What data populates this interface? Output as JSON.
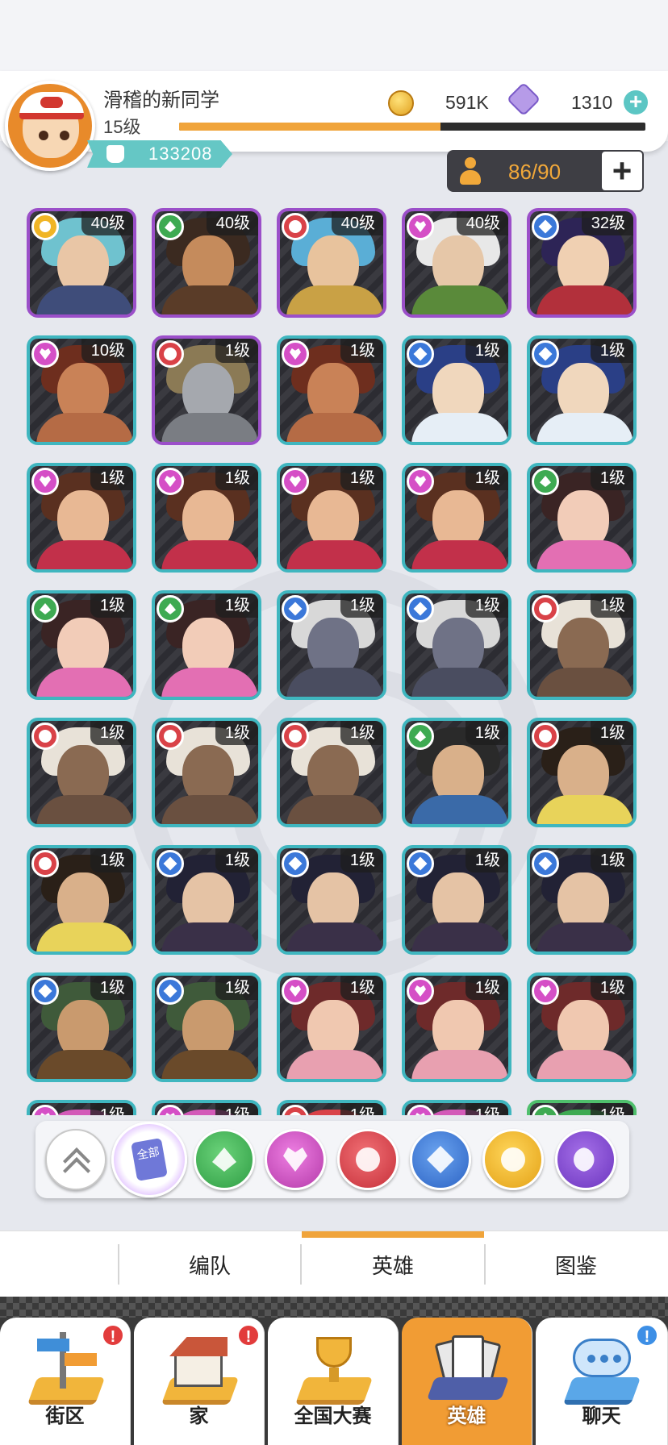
{
  "player": {
    "name": "滑稽的新同学",
    "level": "15级",
    "exp_progress": 0.56,
    "power": "133208"
  },
  "currency": {
    "coins": "591K",
    "gems": "1310",
    "coin_icon": "coin-icon",
    "gem_icon": "gem-icon"
  },
  "capacity": {
    "value": "86/90",
    "icon": "person-icon"
  },
  "colors": {
    "accent": "#f0a43b",
    "teal": "#65c7c5",
    "card_purple": "#9b4fc9",
    "card_teal": "#3fb6bf"
  },
  "heroes": [
    {
      "level": "40级",
      "element": "sun",
      "frame": "purple",
      "hair": "#6fc2cf",
      "skin": "#e9c6a6",
      "body": "#3f4d7a"
    },
    {
      "level": "40级",
      "element": "leaf",
      "frame": "purple",
      "hair": "#3b2a20",
      "skin": "#c58b5c",
      "body": "#5a3c28"
    },
    {
      "level": "40级",
      "element": "flower",
      "frame": "purple",
      "hair": "#5aaed6",
      "skin": "#e8c39d",
      "body": "#c9a145"
    },
    {
      "level": "40级",
      "element": "heart",
      "frame": "purple",
      "hair": "#e8e8e8",
      "skin": "#e6c7a8",
      "body": "#5a8a3a"
    },
    {
      "level": "32级",
      "element": "diamond",
      "frame": "purple",
      "hair": "#2d2456",
      "skin": "#f0d0b2",
      "body": "#b2303b"
    },
    {
      "level": "10级",
      "element": "heart",
      "frame": "teal",
      "hair": "#6e2e1e",
      "skin": "#c98257",
      "body": "#b56b45"
    },
    {
      "level": "1级",
      "element": "flower",
      "frame": "purple",
      "hair": "#8b7a55",
      "skin": "#a5a8ae",
      "body": "#7a7d83"
    },
    {
      "level": "1级",
      "element": "heart",
      "frame": "teal",
      "hair": "#6e2e1e",
      "skin": "#c98257",
      "body": "#b56b45"
    },
    {
      "level": "1级",
      "element": "diamond",
      "frame": "teal",
      "hair": "#2a3f86",
      "skin": "#f0d7bd",
      "body": "#e6eef6"
    },
    {
      "level": "1级",
      "element": "diamond",
      "frame": "teal",
      "hair": "#2a3f86",
      "skin": "#f0d7bd",
      "body": "#e6eef6"
    },
    {
      "level": "1级",
      "element": "heart",
      "frame": "teal",
      "hair": "#5a3020",
      "skin": "#e8b894",
      "body": "#c2304a"
    },
    {
      "level": "1级",
      "element": "heart",
      "frame": "teal",
      "hair": "#5a3020",
      "skin": "#e8b894",
      "body": "#c2304a"
    },
    {
      "level": "1级",
      "element": "heart",
      "frame": "teal",
      "hair": "#5a3020",
      "skin": "#e8b894",
      "body": "#c2304a"
    },
    {
      "level": "1级",
      "element": "heart",
      "frame": "teal",
      "hair": "#5a3020",
      "skin": "#e8b894",
      "body": "#c2304a"
    },
    {
      "level": "1级",
      "element": "leaf",
      "frame": "teal",
      "hair": "#3a2424",
      "skin": "#f2ccb8",
      "body": "#e36fb3"
    },
    {
      "level": "1级",
      "element": "leaf",
      "frame": "teal",
      "hair": "#3a2424",
      "skin": "#f2ccb8",
      "body": "#e36fb3"
    },
    {
      "level": "1级",
      "element": "leaf",
      "frame": "teal",
      "hair": "#3a2424",
      "skin": "#f2ccb8",
      "body": "#e36fb3"
    },
    {
      "level": "1级",
      "element": "diamond",
      "frame": "teal",
      "hair": "#d8d8d8",
      "skin": "#6f7286",
      "body": "#4a4d60"
    },
    {
      "level": "1级",
      "element": "diamond",
      "frame": "teal",
      "hair": "#d8d8d8",
      "skin": "#6f7286",
      "body": "#4a4d60"
    },
    {
      "level": "1级",
      "element": "flower",
      "frame": "teal",
      "hair": "#e8e2d8",
      "skin": "#8a6a52",
      "body": "#6a5040"
    },
    {
      "level": "1级",
      "element": "flower",
      "frame": "teal",
      "hair": "#e8e2d8",
      "skin": "#8a6a52",
      "body": "#6a5040"
    },
    {
      "level": "1级",
      "element": "flower",
      "frame": "teal",
      "hair": "#e8e2d8",
      "skin": "#8a6a52",
      "body": "#6a5040"
    },
    {
      "level": "1级",
      "element": "flower",
      "frame": "teal",
      "hair": "#e8e2d8",
      "skin": "#8a6a52",
      "body": "#6a5040"
    },
    {
      "level": "1级",
      "element": "leaf",
      "frame": "teal",
      "hair": "#2a2a2a",
      "skin": "#d9b08a",
      "body": "#3a6aa8"
    },
    {
      "level": "1级",
      "element": "flower",
      "frame": "teal",
      "hair": "#2a2018",
      "skin": "#d9b08a",
      "body": "#e8d35a"
    },
    {
      "level": "1级",
      "element": "flower",
      "frame": "teal",
      "hair": "#2a2018",
      "skin": "#d9b08a",
      "body": "#e8d35a"
    },
    {
      "level": "1级",
      "element": "diamond",
      "frame": "teal",
      "hair": "#222235",
      "skin": "#e5c3a5",
      "body": "#3a3048"
    },
    {
      "level": "1级",
      "element": "diamond",
      "frame": "teal",
      "hair": "#222235",
      "skin": "#e5c3a5",
      "body": "#3a3048"
    },
    {
      "level": "1级",
      "element": "diamond",
      "frame": "teal",
      "hair": "#222235",
      "skin": "#e5c3a5",
      "body": "#3a3048"
    },
    {
      "level": "1级",
      "element": "diamond",
      "frame": "teal",
      "hair": "#222235",
      "skin": "#e5c3a5",
      "body": "#3a3048"
    },
    {
      "level": "1级",
      "element": "diamond",
      "frame": "teal",
      "hair": "#3f5a3a",
      "skin": "#c99a6e",
      "body": "#6a4a2a"
    },
    {
      "level": "1级",
      "element": "diamond",
      "frame": "teal",
      "hair": "#3f5a3a",
      "skin": "#c99a6e",
      "body": "#6a4a2a"
    },
    {
      "level": "1级",
      "element": "heart",
      "frame": "teal",
      "hair": "#6e2a2a",
      "skin": "#f0c8b0",
      "body": "#e8a0b0"
    },
    {
      "level": "1级",
      "element": "heart",
      "frame": "teal",
      "hair": "#6e2a2a",
      "skin": "#f0c8b0",
      "body": "#e8a0b0"
    },
    {
      "level": "1级",
      "element": "heart",
      "frame": "teal",
      "hair": "#6e2a2a",
      "skin": "#f0c8b0",
      "body": "#e8a0b0"
    },
    {
      "level": "1级",
      "element": "heart",
      "frame": "teal",
      "hair": "#d35ab8",
      "skin": "#f0c8b0",
      "body": "#b04a9a"
    },
    {
      "level": "1级",
      "element": "heart",
      "frame": "teal",
      "hair": "#d35ab8",
      "skin": "#f0c8b0",
      "body": "#b04a9a"
    },
    {
      "level": "1级",
      "element": "flower",
      "frame": "teal",
      "hair": "#d94248",
      "skin": "#f0c8b0",
      "body": "#b03a3a"
    },
    {
      "level": "1级",
      "element": "heart",
      "frame": "teal",
      "hair": "#d35ab8",
      "skin": "#f0c8b0",
      "body": "#b04a9a"
    },
    {
      "level": "1级",
      "element": "leaf",
      "frame": "green",
      "hair": "#3eaa52",
      "skin": "#f0c8b0",
      "body": "#3a8a4a"
    }
  ],
  "filters": {
    "collapse_icon": "double-chevron-up-icon",
    "all_label": "全部",
    "items": [
      {
        "name": "leaf",
        "icon": "spade-leaf-icon"
      },
      {
        "name": "heart",
        "icon": "heart-gem-icon"
      },
      {
        "name": "flower",
        "icon": "club-flower-icon"
      },
      {
        "name": "diamond",
        "icon": "diamond-icon"
      },
      {
        "name": "sun",
        "icon": "sun-icon"
      },
      {
        "name": "moon",
        "icon": "moon-icon"
      }
    ]
  },
  "subtabs": {
    "team": "编队",
    "heroes": "英雄",
    "codex": "图鉴",
    "active": "英雄"
  },
  "nav": {
    "items": [
      {
        "label": "街区",
        "icon": "signpost-icon",
        "badge": "!"
      },
      {
        "label": "家",
        "icon": "house-icon",
        "badge": "!"
      },
      {
        "label": "全国大赛",
        "icon": "trophy-icon",
        "badge": ""
      },
      {
        "label": "英雄",
        "icon": "hero-cards-icon",
        "badge": "",
        "active": true
      },
      {
        "label": "聊天",
        "icon": "chat-bubble-icon",
        "badge": "!"
      }
    ]
  }
}
